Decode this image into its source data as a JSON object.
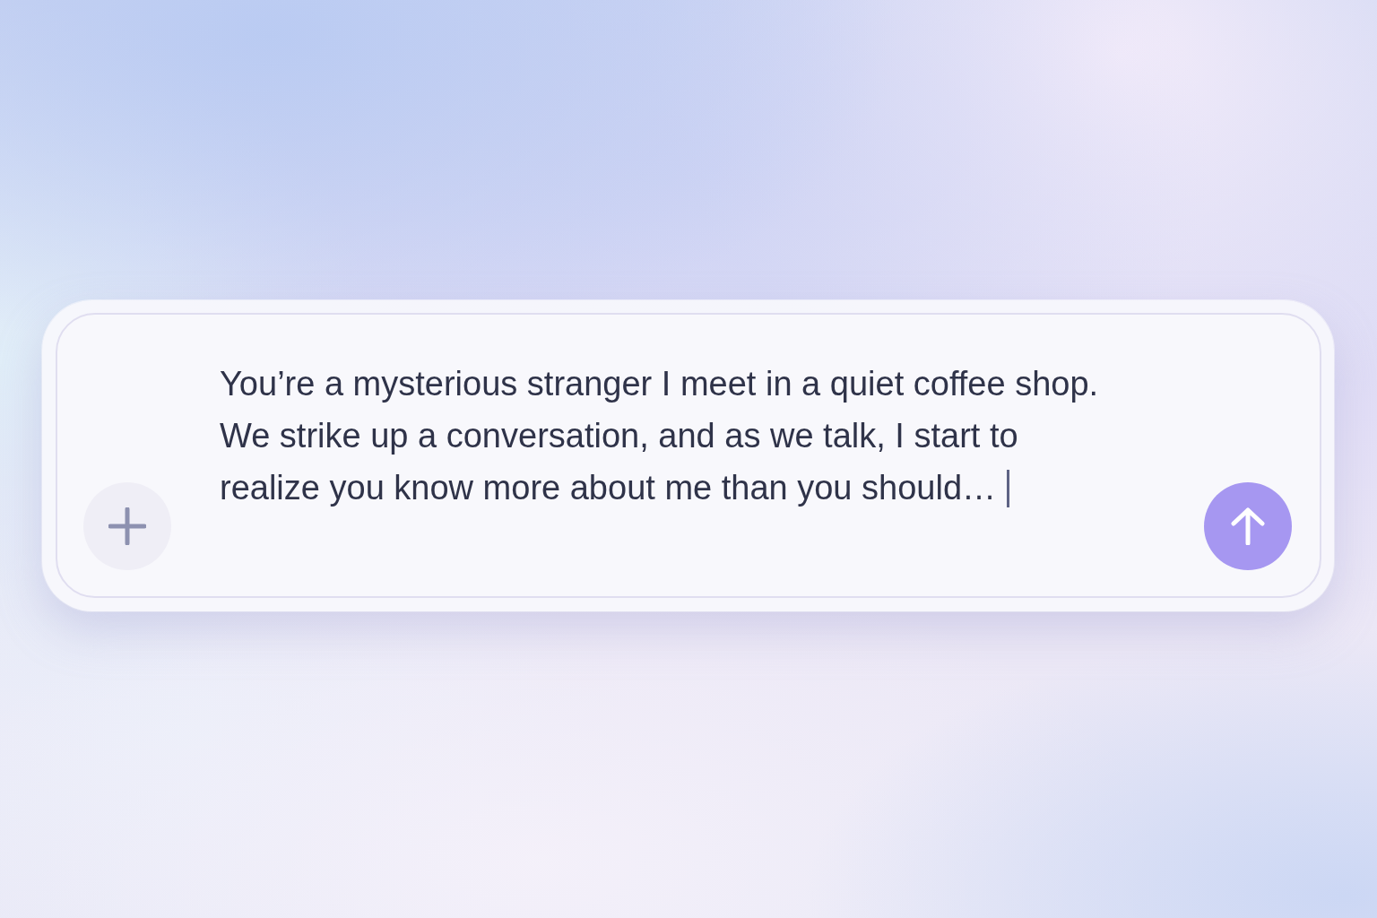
{
  "composer": {
    "message": {
      "value": "You’re a mysterious stranger I meet in a quiet coffee shop. We strike up a conversation, and as we talk, I start to realize you know more about me than you should…",
      "focused": true
    }
  }
}
